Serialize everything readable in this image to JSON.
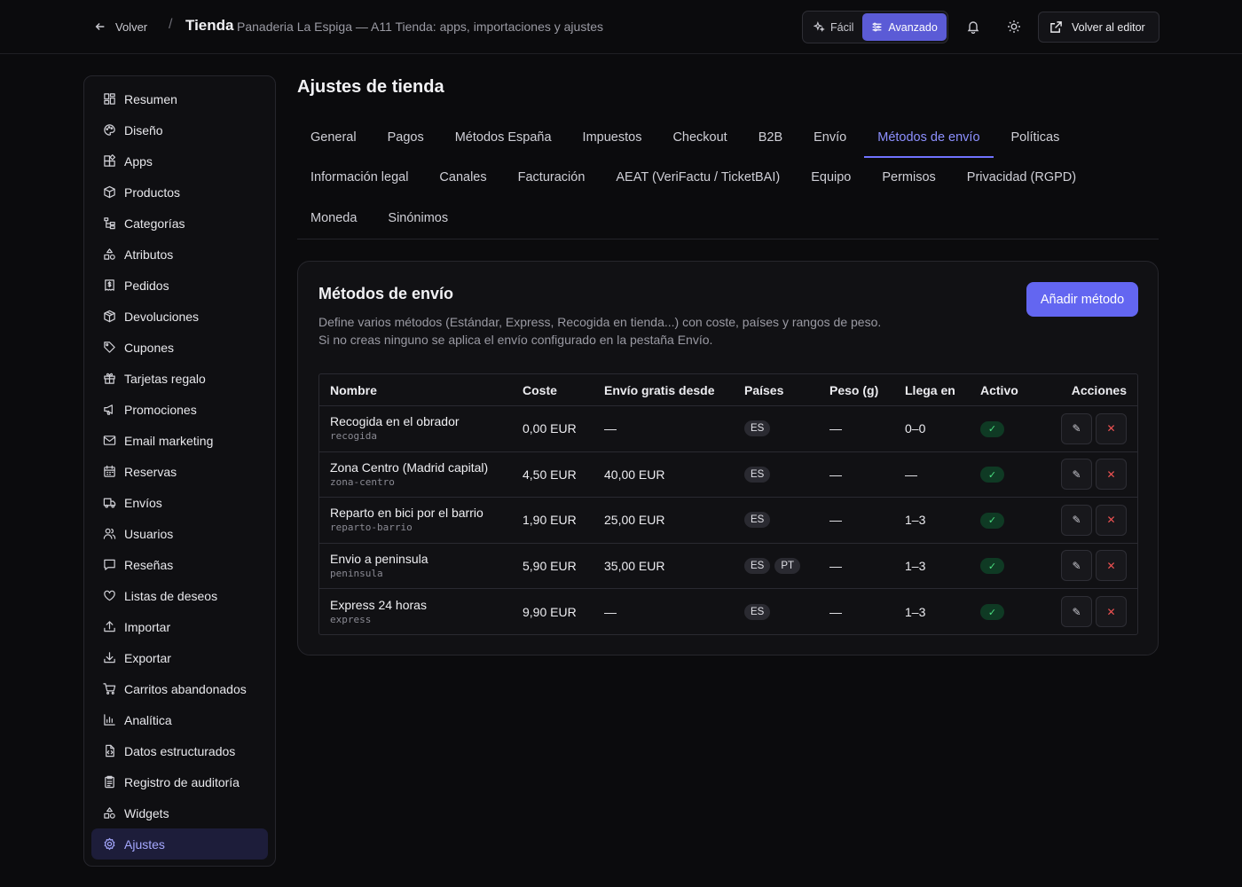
{
  "header": {
    "back_label": "Volver",
    "separator": "/",
    "title": "Tienda",
    "subtitle": "Panaderia La Espiga — A11 Tienda: apps, importaciones y ajustes",
    "mode_easy": "Fácil",
    "mode_advanced": "Avanzado",
    "editor_label": "Volver al editor"
  },
  "sidebar": {
    "items": [
      {
        "label": "Resumen",
        "icon": "dashboard-icon"
      },
      {
        "label": "Diseño",
        "icon": "palette-icon"
      },
      {
        "label": "Apps",
        "icon": "apps-icon"
      },
      {
        "label": "Productos",
        "icon": "box-icon"
      },
      {
        "label": "Categorías",
        "icon": "tree-icon"
      },
      {
        "label": "Atributos",
        "icon": "shapes-icon"
      },
      {
        "label": "Pedidos",
        "icon": "receipt-icon"
      },
      {
        "label": "Devoluciones",
        "icon": "box-return-icon"
      },
      {
        "label": "Cupones",
        "icon": "tag-icon"
      },
      {
        "label": "Tarjetas regalo",
        "icon": "gift-icon"
      },
      {
        "label": "Promociones",
        "icon": "megaphone-icon"
      },
      {
        "label": "Email marketing",
        "icon": "mail-icon"
      },
      {
        "label": "Reservas",
        "icon": "calendar-icon"
      },
      {
        "label": "Envíos",
        "icon": "truck-icon"
      },
      {
        "label": "Usuarios",
        "icon": "users-icon"
      },
      {
        "label": "Reseñas",
        "icon": "message-icon"
      },
      {
        "label": "Listas de deseos",
        "icon": "heart-icon"
      },
      {
        "label": "Importar",
        "icon": "upload-icon"
      },
      {
        "label": "Exportar",
        "icon": "download-icon"
      },
      {
        "label": "Carritos abandonados",
        "icon": "cart-icon"
      },
      {
        "label": "Analítica",
        "icon": "chart-icon"
      },
      {
        "label": "Datos estructurados",
        "icon": "file-code-icon"
      },
      {
        "label": "Registro de auditoría",
        "icon": "clipboard-icon"
      },
      {
        "label": "Widgets",
        "icon": "widgets-icon"
      },
      {
        "label": "Ajustes",
        "icon": "gear-icon",
        "active": true
      }
    ]
  },
  "main": {
    "title": "Ajustes de tienda",
    "tabs_rows": [
      [
        "General",
        "Pagos",
        "Métodos España",
        "Impuestos",
        "Checkout",
        "B2B",
        "Envío",
        "Métodos de envío",
        "Políticas"
      ],
      [
        "Información legal",
        "Canales",
        "Facturación",
        "AEAT (VeriFactu / TicketBAI)",
        "Equipo",
        "Permisos",
        "Privacidad (RGPD)"
      ],
      [
        "Moneda",
        "Sinónimos"
      ]
    ],
    "active_tab": "Métodos de envío"
  },
  "card": {
    "title": "Métodos de envío",
    "desc_line1": "Define varios métodos (Estándar, Express, Recogida en tienda...) con coste, países y rangos de peso.",
    "desc_line2": "Si no creas ninguno se aplica el envío configurado en la pestaña Envío.",
    "add_button": "Añadir método"
  },
  "table": {
    "headers": {
      "name": "Nombre",
      "cost": "Coste",
      "free_from": "Envío gratis desde",
      "countries": "Países",
      "weight": "Peso (g)",
      "eta": "Llega en",
      "active": "Activo",
      "actions": "Acciones"
    },
    "rows": [
      {
        "name": "Recogida en el obrador",
        "slug": "recogida",
        "cost": "0,00 EUR",
        "free_from": "—",
        "countries": [
          "ES"
        ],
        "weight": "—",
        "eta": "0–0",
        "active": "✓"
      },
      {
        "name": "Zona Centro (Madrid capital)",
        "slug": "zona-centro",
        "cost": "4,50 EUR",
        "free_from": "40,00 EUR",
        "countries": [
          "ES"
        ],
        "weight": "—",
        "eta": "—",
        "active": "✓"
      },
      {
        "name": "Reparto en bici por el barrio",
        "slug": "reparto-barrio",
        "cost": "1,90 EUR",
        "free_from": "25,00 EUR",
        "countries": [
          "ES"
        ],
        "weight": "—",
        "eta": "1–3",
        "active": "✓"
      },
      {
        "name": "Envio a peninsula",
        "slug": "peninsula",
        "cost": "5,90 EUR",
        "free_from": "35,00 EUR",
        "countries": [
          "ES",
          "PT"
        ],
        "weight": "—",
        "eta": "1–3",
        "active": "✓"
      },
      {
        "name": "Express 24 horas",
        "slug": "express",
        "cost": "9,90 EUR",
        "free_from": "—",
        "countries": [
          "ES"
        ],
        "weight": "—",
        "eta": "1–3",
        "active": "✓"
      }
    ],
    "edit_glyph": "✎",
    "delete_glyph": "✕"
  },
  "colors": {
    "accent": "#6366f1",
    "background": "#0b0b0d",
    "active_tab": "#8d90ff",
    "success": "#4ade80",
    "danger": "#f05252"
  }
}
